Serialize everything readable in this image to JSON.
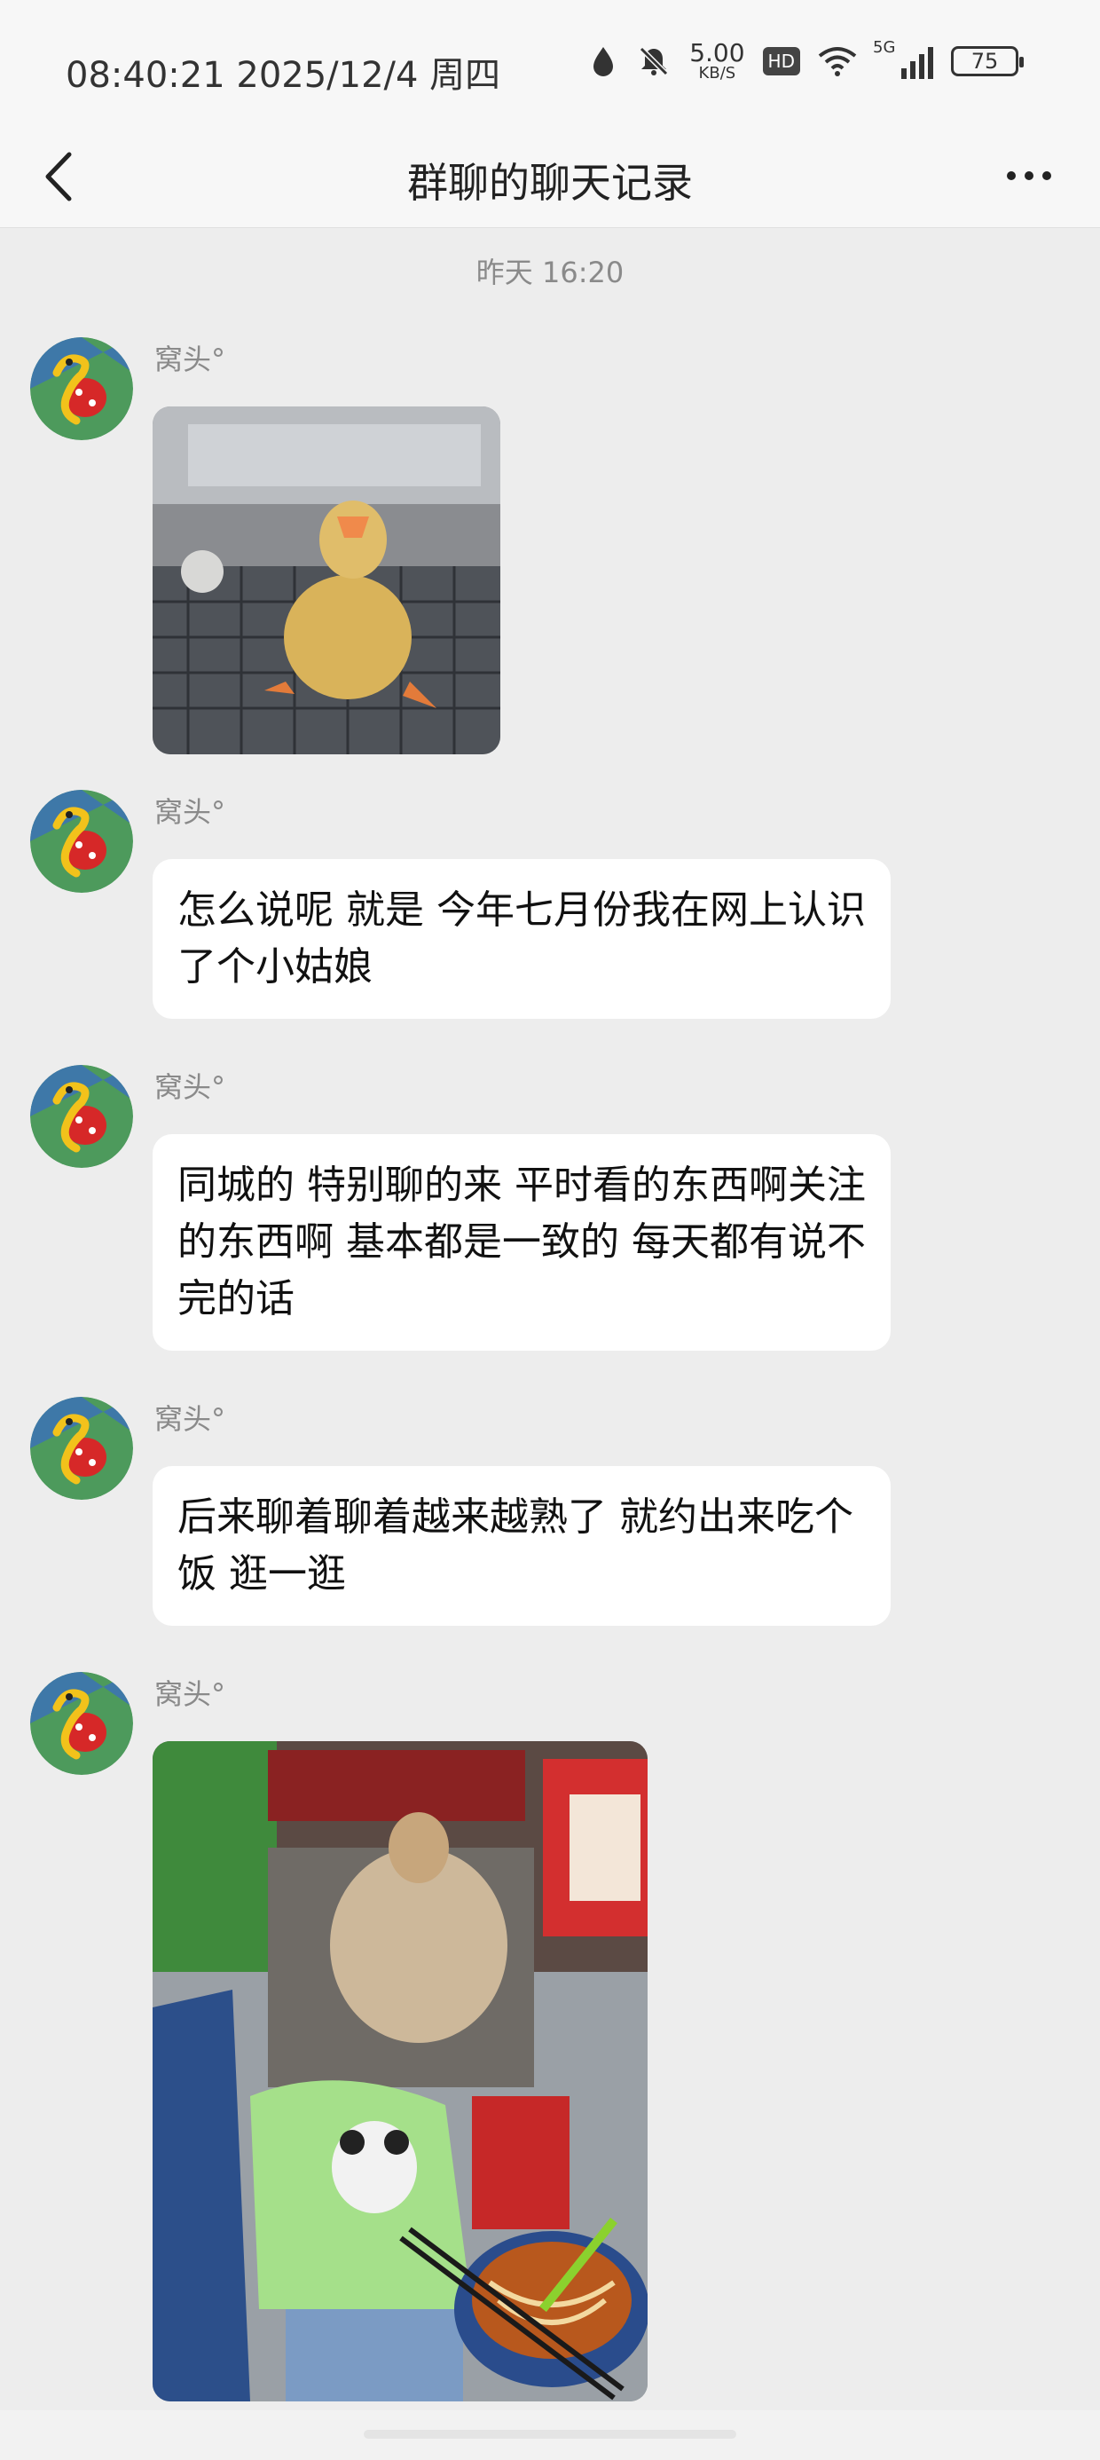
{
  "status_bar": {
    "time": "08:40:21 2025/12/4 周四",
    "net_speed": "5.00",
    "net_unit": "KB/S",
    "hd": "HD",
    "signal": "5G",
    "battery": "75"
  },
  "nav": {
    "title": "群聊的聊天记录"
  },
  "chat": {
    "timestamp": "昨天 16:20",
    "messages": [
      {
        "sender": "窝头°",
        "type": "image",
        "image": "duckling-photo"
      },
      {
        "sender": "窝头°",
        "type": "text",
        "text": "怎么说呢 就是 今年七月份我在网上认识了个小姑娘"
      },
      {
        "sender": "窝头°",
        "type": "text",
        "text": "同城的 特别聊的来 平时看的东西啊关注的东西啊 基本都是一致的 每天都有说不完的话"
      },
      {
        "sender": "窝头°",
        "type": "text",
        "text": "后来聊着聊着越来越熟了 就约出来吃个饭 逛一逛"
      },
      {
        "sender": "窝头°",
        "type": "image",
        "image": "restaurant-photo"
      }
    ]
  },
  "colors": {
    "background": "#ededed",
    "bubble": "#ffffff",
    "muted_text": "#8a8a8a"
  }
}
